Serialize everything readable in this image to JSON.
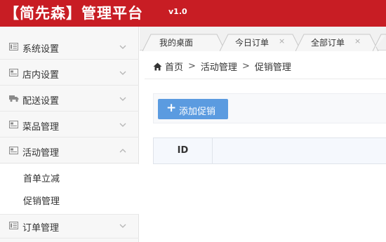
{
  "header": {
    "brand": "【简先森】管理平台",
    "version": "v1.0",
    "bg_color": "#c81d24"
  },
  "sidebar": {
    "items": [
      {
        "label": "系统设置",
        "icon": "list-doc-icon",
        "expanded": false
      },
      {
        "label": "店内设置",
        "icon": "image-card-icon",
        "expanded": false
      },
      {
        "label": "配送设置",
        "icon": "truck-icon",
        "expanded": false
      },
      {
        "label": "菜品管理",
        "icon": "image-card-icon",
        "expanded": false
      },
      {
        "label": "活动管理",
        "icon": "image-card-icon",
        "expanded": true
      },
      {
        "label": "订单管理",
        "icon": "list-doc-icon",
        "expanded": false
      }
    ],
    "subitems": [
      {
        "label": "首单立减"
      },
      {
        "label": "促销管理"
      }
    ]
  },
  "tabs": [
    {
      "label": "我的桌面",
      "closable": false
    },
    {
      "label": "今日订单",
      "closable": true,
      "close": "×"
    },
    {
      "label": "全部订单",
      "closable": true,
      "close": "×"
    }
  ],
  "breadcrumb": {
    "home": "首页",
    "sep": ">",
    "level1": "活动管理",
    "level2": "促销管理"
  },
  "toolbar": {
    "add_label": "添加促销",
    "add_plus": "+",
    "accent": "#5b9be0"
  },
  "table": {
    "columns": [
      "ID"
    ]
  }
}
